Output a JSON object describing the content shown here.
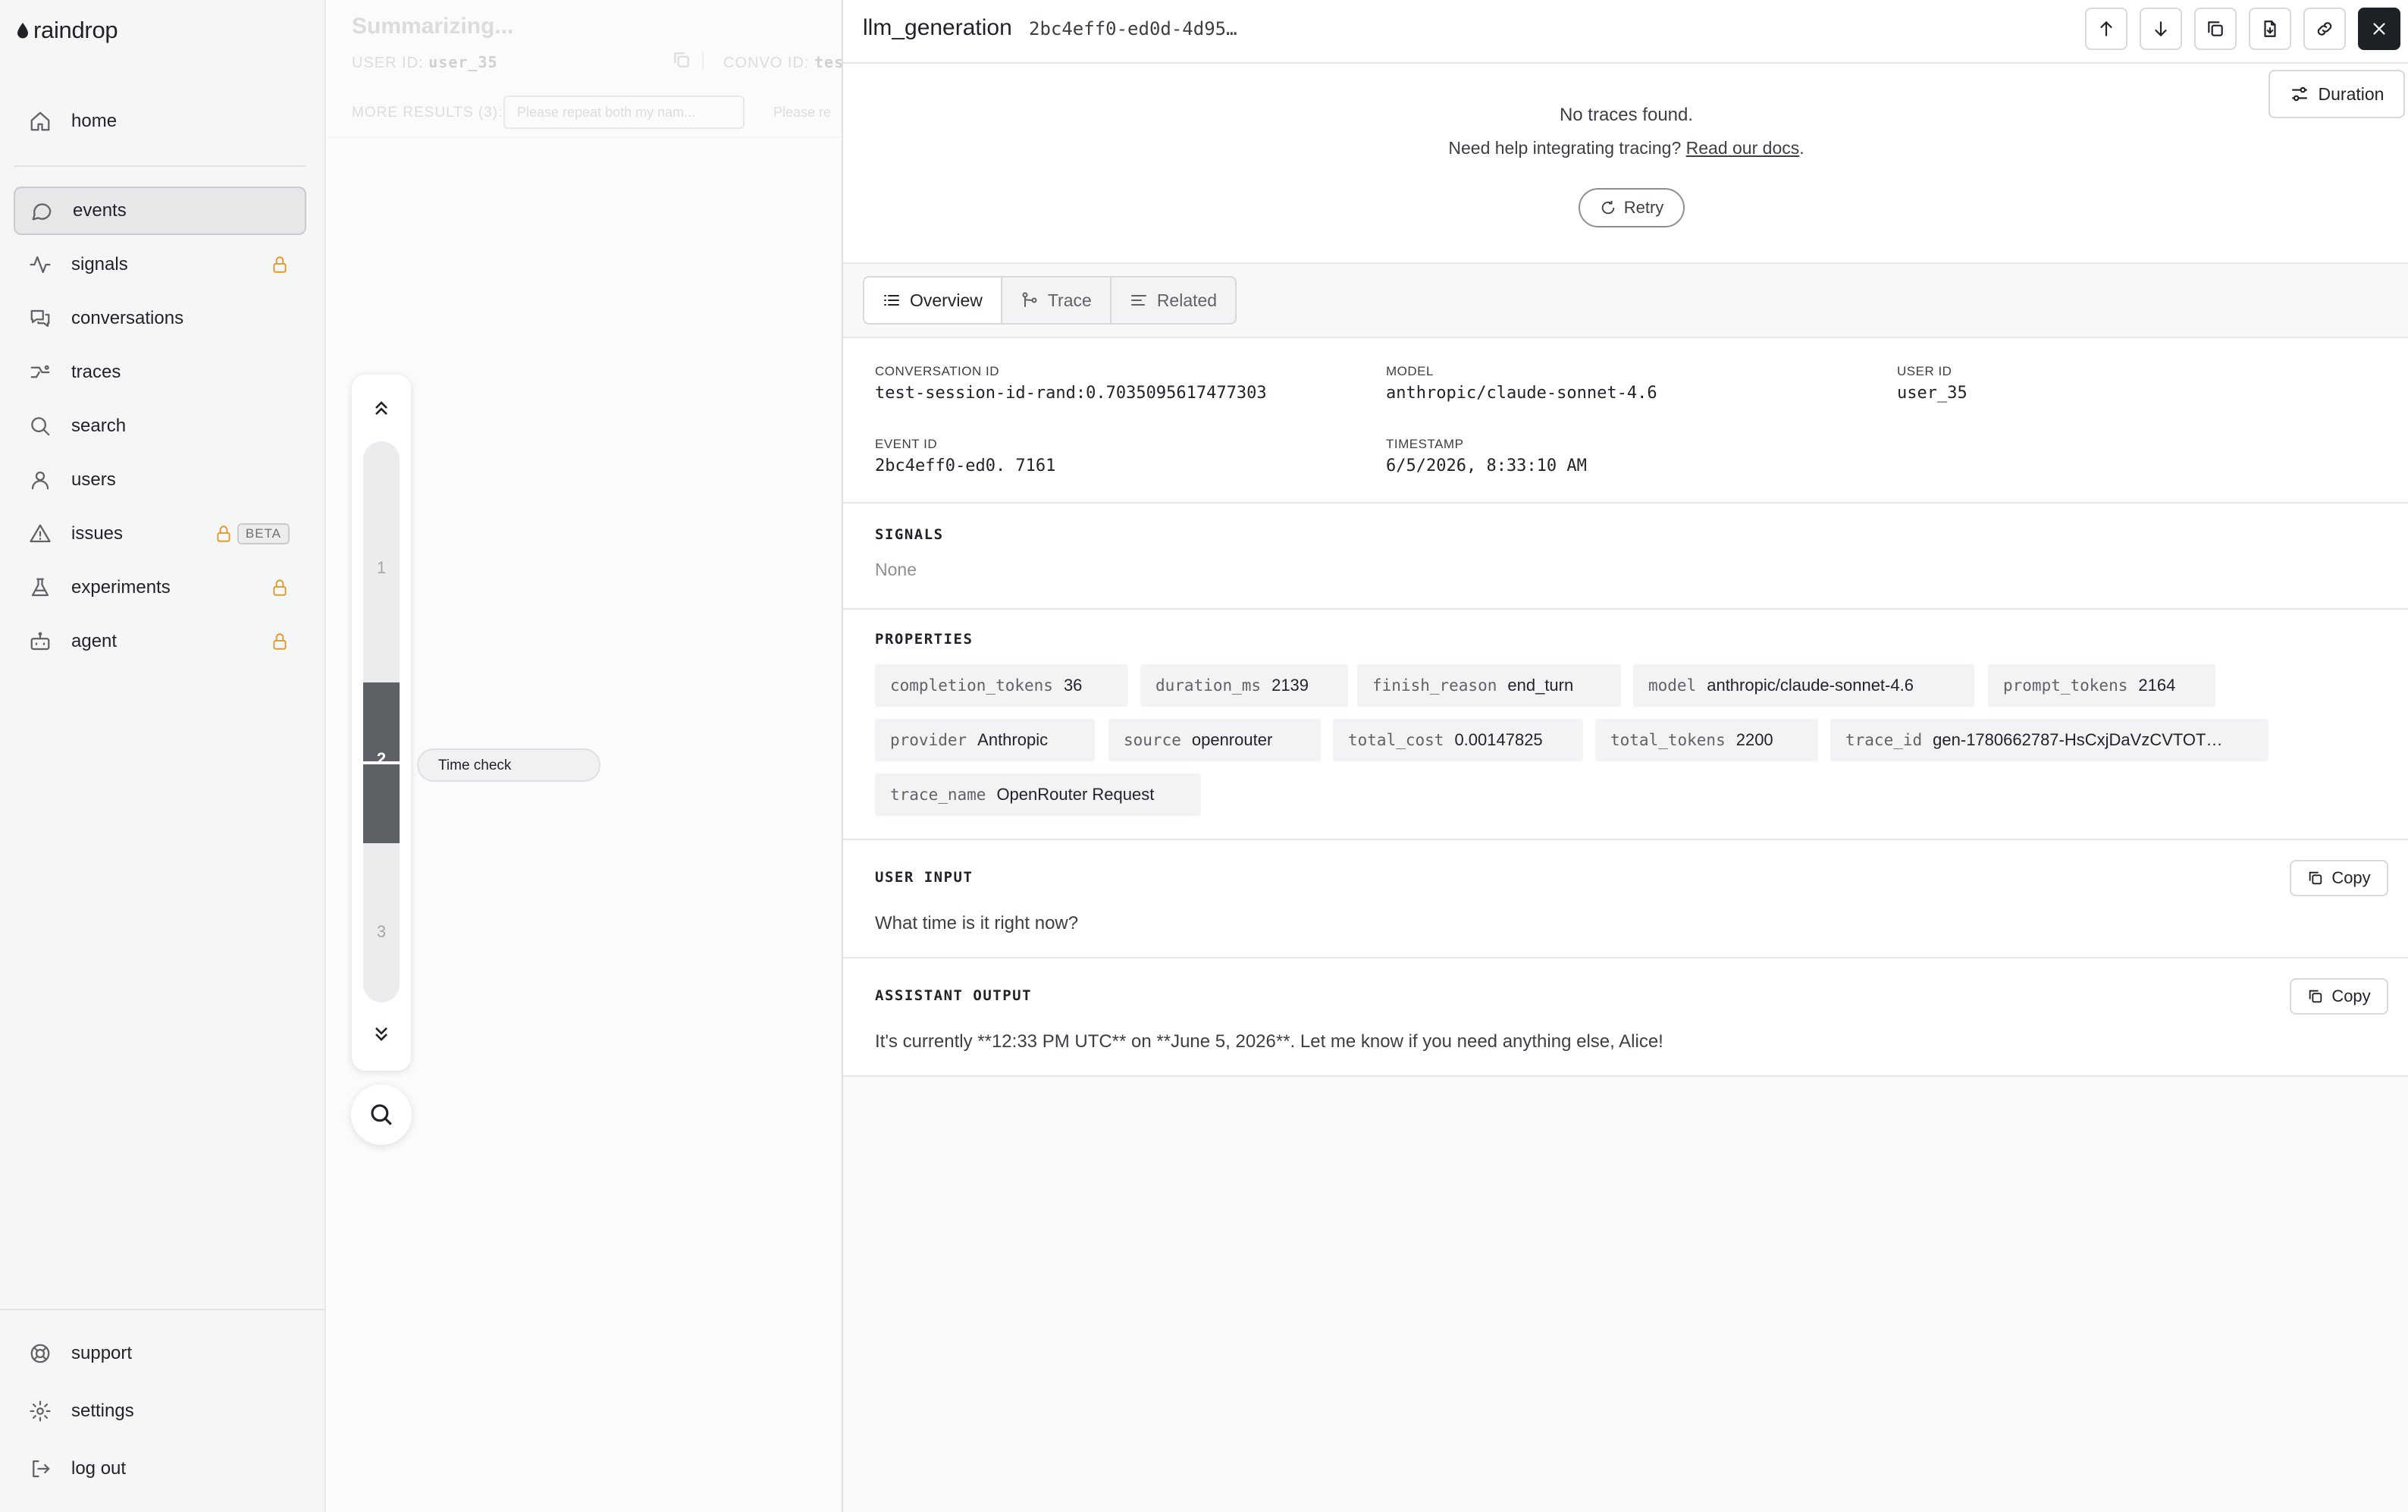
{
  "brand": {
    "name": "raindrop"
  },
  "sidebar": {
    "items": [
      {
        "label": "home",
        "icon": "home-icon"
      },
      {
        "label": "events",
        "icon": "chat-bubble-icon",
        "active": true
      },
      {
        "label": "signals",
        "icon": "activity-icon",
        "locked": true
      },
      {
        "label": "conversations",
        "icon": "conversations-icon"
      },
      {
        "label": "traces",
        "icon": "traces-icon"
      },
      {
        "label": "search",
        "icon": "search-icon"
      },
      {
        "label": "users",
        "icon": "user-icon"
      },
      {
        "label": "issues",
        "icon": "warning-icon",
        "locked": true,
        "badge": "BETA"
      },
      {
        "label": "experiments",
        "icon": "flask-icon",
        "locked": true
      },
      {
        "label": "agent",
        "icon": "bot-icon",
        "locked": true
      }
    ],
    "bottom": [
      {
        "label": "support",
        "icon": "lifebuoy-icon"
      },
      {
        "label": "settings",
        "icon": "gear-icon"
      },
      {
        "label": "log out",
        "icon": "logout-icon"
      }
    ]
  },
  "background_view": {
    "title": "Summarizing...",
    "user_id_label": "USER ID:",
    "user_id_value": "user_35",
    "convo_id_label": "CONVO ID:",
    "convo_id_value": "tes",
    "more_results": "MORE RESULTS (3):",
    "chips": [
      "Please repeat both my nam...",
      "Please re"
    ],
    "timeline": {
      "steps": [
        "1",
        "2",
        "3"
      ],
      "active_step": "2",
      "tooltip": "Time check"
    }
  },
  "panel": {
    "title": "llm_generation",
    "event_id_short": "2bc4eff0-ed0d-4d95…",
    "header_buttons": [
      "arrow-up-icon",
      "arrow-down-icon",
      "duplicate-icon",
      "export-icon",
      "link-icon",
      "close-icon"
    ],
    "trace": {
      "duration_label": "Duration",
      "no_traces": "No traces found.",
      "help_text": "Need help integrating tracing?",
      "help_link": "Read our docs",
      "help_suffix": ".",
      "retry_label": "Retry"
    },
    "tabs": [
      {
        "label": "Overview",
        "icon": "list-icon",
        "active": true
      },
      {
        "label": "Trace",
        "icon": "trace-icon"
      },
      {
        "label": "Related",
        "icon": "lines-icon"
      }
    ],
    "overview": {
      "conversation_id_label": "CONVERSATION ID",
      "conversation_id": "test-session-id-rand:0.7035095617477303",
      "model_label": "MODEL",
      "model": "anthropic/claude-sonnet-4.6",
      "user_id_label": "USER ID",
      "user_id": "user_35",
      "event_id_label": "EVENT ID",
      "event_id": "2bc4eff0-ed0. 7161",
      "timestamp_label": "TIMESTAMP",
      "timestamp": "6/5/2026, 8:33:10 AM"
    },
    "signals": {
      "title": "SIGNALS",
      "value": "None"
    },
    "properties": {
      "title": "PROPERTIES",
      "items": [
        {
          "key": "completion_tokens",
          "value": "36"
        },
        {
          "key": "duration_ms",
          "value": "2139"
        },
        {
          "key": "finish_reason",
          "value": "end_turn"
        },
        {
          "key": "model",
          "value": "anthropic/claude-sonnet-4.6"
        },
        {
          "key": "prompt_tokens",
          "value": "2164"
        },
        {
          "key": "provider",
          "value": "Anthropic"
        },
        {
          "key": "source",
          "value": "openrouter"
        },
        {
          "key": "total_cost",
          "value": "0.00147825"
        },
        {
          "key": "total_tokens",
          "value": "2200"
        },
        {
          "key": "trace_id",
          "value": "gen-1780662787-HsCxjDaVzCVTOT…"
        },
        {
          "key": "trace_name",
          "value": "OpenRouter Request"
        }
      ]
    },
    "user_input": {
      "title": "USER INPUT",
      "copy_label": "Copy",
      "text": "What time is it right now?"
    },
    "assistant_output": {
      "title": "ASSISTANT OUTPUT",
      "copy_label": "Copy",
      "text": "It's currently **12:33 PM UTC** on **June 5, 2026**. Let me know if you need anything else, Alice!"
    }
  },
  "colors": {
    "lock_accent": "#e09b2d",
    "close_button": "#1c2126",
    "timeline_active": "#5d6166"
  }
}
